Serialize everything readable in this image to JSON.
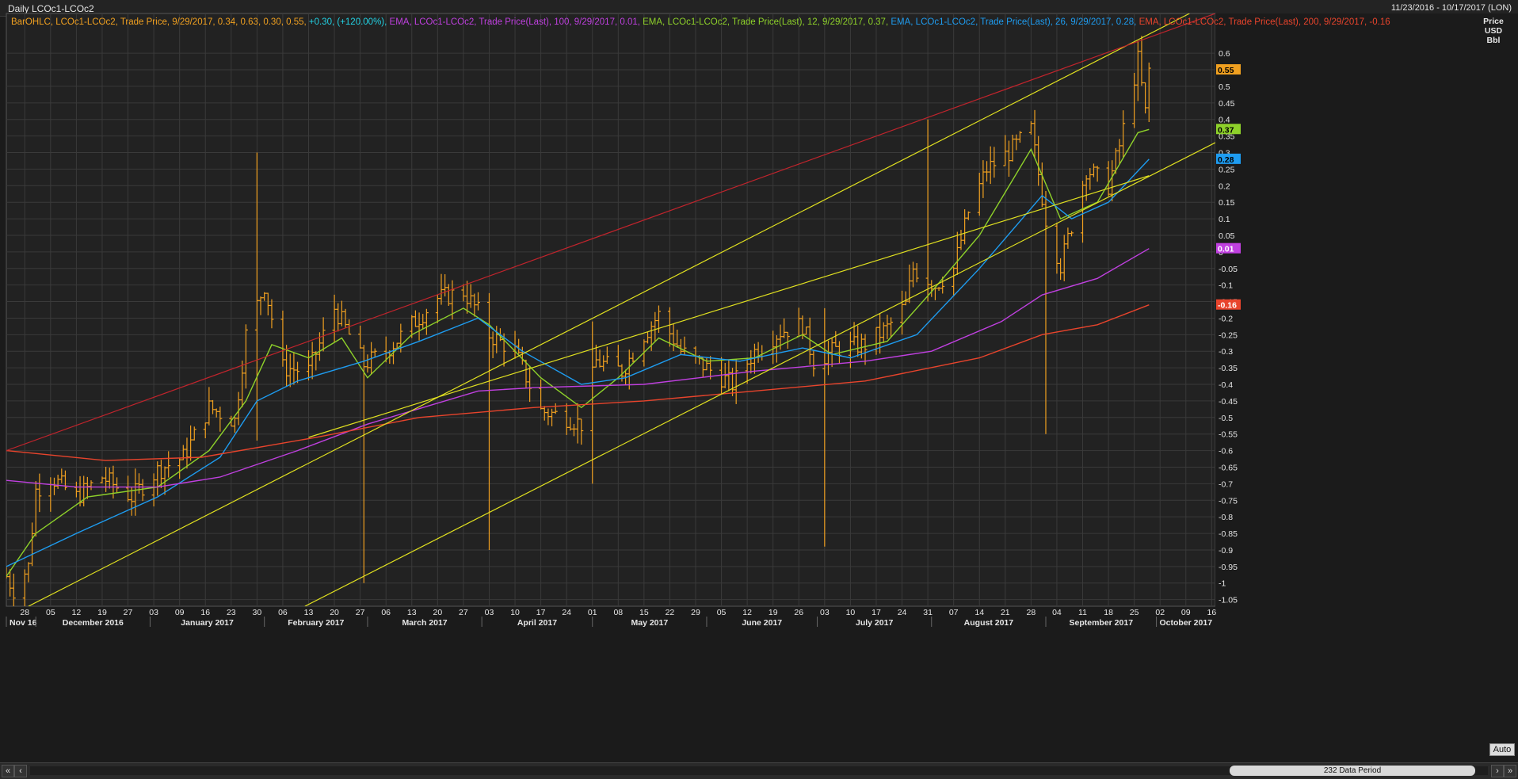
{
  "window": {
    "title": "Daily LCOc1-LCOc2",
    "date_range": "11/23/2016 - 10/17/2017 (LON)"
  },
  "legend": [
    {
      "text": "BarOHLC, LCOc1-LCOc2, Trade Price,  9/29/2017, 0.34, 0.63, 0.30, 0.55, ",
      "color": "#f0a020"
    },
    {
      "text": "+0.30, (+120.00%), ",
      "color": "#22d4e6"
    },
    {
      "text": "EMA, LCOc1-LCOc2, Trade Price(Last),  100,  9/29/2017, 0.01, ",
      "color": "#c040e0"
    },
    {
      "text": "EMA, LCOc1-LCOc2, Trade Price(Last),  12,  9/29/2017, 0.37, ",
      "color": "#8ed12a"
    },
    {
      "text": "EMA, LCOc1-LCOc2, Trade Price(Last),  26,  9/29/2017, 0.28, ",
      "color": "#1e9cf0"
    },
    {
      "text": "EMA, LCOc1-LCOc2, Trade Price(Last),  200,  9/29/2017, -0.16",
      "color": "#e8442c"
    }
  ],
  "axis": {
    "price_header": [
      "Price",
      "USD",
      "Bbl"
    ]
  },
  "scroll": {
    "period_label": "232 Data Period",
    "auto_label": "Auto",
    "left_double": "«",
    "left_single": "‹",
    "right_single": "›",
    "right_double": "»"
  },
  "chart_data": {
    "type": "ohlc",
    "title": "Daily LCOc1-LCOc2",
    "ylabel": "Price USD Bbl",
    "ylim": [
      -1.07,
      0.72
    ],
    "y_ticks": [
      0.6,
      0.55,
      0.5,
      0.45,
      0.4,
      0.35,
      0.3,
      0.25,
      0.2,
      0.15,
      0.1,
      0.05,
      0,
      -0.05,
      -0.1,
      -0.15,
      -0.2,
      -0.25,
      -0.3,
      -0.35,
      -0.4,
      -0.45,
      -0.5,
      -0.55,
      -0.6,
      -0.65,
      -0.7,
      -0.75,
      -0.8,
      -0.85,
      -0.9,
      -0.95,
      -1,
      -1.05
    ],
    "y_tick_labels": [
      "0.6",
      "0.55",
      "0.5",
      "0.45",
      "0.4",
      "0.35",
      "0.3",
      "0.25",
      "0.2",
      "0.15",
      "0.1",
      "0.05",
      "0",
      "-0.05",
      "-0.1",
      "-0.15",
      "-0.2",
      "-0.25",
      "-0.3",
      "-0.35",
      "-0.4",
      "-0.45",
      "-0.5",
      "-0.55",
      "-0.6",
      "-0.65",
      "-0.7",
      "-0.75",
      "-0.8",
      "-0.85",
      "-0.9",
      "-0.95",
      "-1",
      "-1.05"
    ],
    "x_day_ticks": [
      "28",
      "05",
      "12",
      "19",
      "27",
      "03",
      "09",
      "16",
      "23",
      "30",
      "06",
      "13",
      "20",
      "27",
      "06",
      "13",
      "20",
      "27",
      "03",
      "10",
      "17",
      "24",
      "01",
      "08",
      "15",
      "22",
      "29",
      "05",
      "12",
      "19",
      "26",
      "03",
      "10",
      "17",
      "24",
      "31",
      "07",
      "14",
      "21",
      "28",
      "04",
      "11",
      "18",
      "25",
      "02",
      "09",
      "16"
    ],
    "x_month_labels": [
      "Nov 16",
      "December 2016",
      "January 2017",
      "February 2017",
      "March 2017",
      "April 2017",
      "May 2017",
      "June 2017",
      "July 2017",
      "August 2017",
      "September 2017",
      "October 2017"
    ],
    "x_start": "2016-11-23",
    "x_end": "2017-10-17",
    "ohlc_anchors": [
      [
        "2016-11-23",
        -0.98
      ],
      [
        "2016-11-25",
        -1.02
      ],
      [
        "2016-11-29",
        -0.95
      ],
      [
        "2016-12-01",
        -0.72
      ],
      [
        "2016-12-05",
        -0.68
      ],
      [
        "2016-12-12",
        -0.74
      ],
      [
        "2016-12-19",
        -0.68
      ],
      [
        "2016-12-27",
        -0.74
      ],
      [
        "2017-01-03",
        -0.66
      ],
      [
        "2017-01-10",
        -0.62
      ],
      [
        "2017-01-17",
        -0.47
      ],
      [
        "2017-01-24",
        -0.51
      ],
      [
        "2017-01-27",
        -0.25
      ],
      [
        "2017-02-01",
        -0.1
      ],
      [
        "2017-02-06",
        -0.35
      ],
      [
        "2017-02-13",
        -0.36
      ],
      [
        "2017-02-20",
        -0.17
      ],
      [
        "2017-02-24",
        -0.25
      ],
      [
        "2017-02-28",
        -0.34
      ],
      [
        "2017-03-06",
        -0.3
      ],
      [
        "2017-03-13",
        -0.22
      ],
      [
        "2017-03-20",
        -0.14
      ],
      [
        "2017-03-27",
        -0.12
      ],
      [
        "2017-03-31",
        -0.18
      ],
      [
        "2017-04-03",
        -0.25
      ],
      [
        "2017-04-10",
        -0.3
      ],
      [
        "2017-04-17",
        -0.48
      ],
      [
        "2017-04-24",
        -0.5
      ],
      [
        "2017-04-28",
        -0.52
      ],
      [
        "2017-05-02",
        -0.33
      ],
      [
        "2017-05-09",
        -0.36
      ],
      [
        "2017-05-15",
        -0.25
      ],
      [
        "2017-05-19",
        -0.19
      ],
      [
        "2017-05-25",
        -0.3
      ],
      [
        "2017-06-01",
        -0.35
      ],
      [
        "2017-06-08",
        -0.4
      ],
      [
        "2017-06-14",
        -0.3
      ],
      [
        "2017-06-21",
        -0.24
      ],
      [
        "2017-06-27",
        -0.22
      ],
      [
        "2017-06-30",
        -0.33
      ],
      [
        "2017-07-07",
        -0.29
      ],
      [
        "2017-07-14",
        -0.28
      ],
      [
        "2017-07-20",
        -0.23
      ],
      [
        "2017-07-25",
        -0.16
      ],
      [
        "2017-07-27",
        -0.05
      ],
      [
        "2017-08-02",
        -0.1
      ],
      [
        "2017-08-07",
        -0.05
      ],
      [
        "2017-08-11",
        0.12
      ],
      [
        "2017-08-16",
        0.25
      ],
      [
        "2017-08-22",
        0.3
      ],
      [
        "2017-08-28",
        0.37
      ],
      [
        "2017-09-01",
        0.1
      ],
      [
        "2017-09-05",
        -0.04
      ],
      [
        "2017-09-08",
        0.08
      ],
      [
        "2017-09-12",
        0.25
      ],
      [
        "2017-09-18",
        0.2
      ],
      [
        "2017-09-21",
        0.32
      ],
      [
        "2017-09-26",
        0.58
      ],
      [
        "2017-09-28",
        0.42
      ],
      [
        "2017-09-29",
        0.55
      ]
    ],
    "spikes": [
      {
        "date": "2017-01-30",
        "high": 0.3,
        "low": -0.57
      },
      {
        "date": "2017-02-28",
        "high": -0.37,
        "low": -1.0
      },
      {
        "date": "2017-04-03",
        "high": -0.23,
        "low": -0.9
      },
      {
        "date": "2017-05-01",
        "high": -0.21,
        "low": -0.7
      },
      {
        "date": "2017-07-03",
        "high": -0.17,
        "low": -0.89
      },
      {
        "date": "2017-07-31",
        "high": 0.4,
        "low": -0.15
      },
      {
        "date": "2017-09-01",
        "high": 0.1,
        "low": -0.55
      }
    ],
    "series": [
      {
        "name": "EMA 12",
        "color": "#8ed12a",
        "points": [
          [
            "2016-11-23",
            -0.98
          ],
          [
            "2016-12-01",
            -0.85
          ],
          [
            "2016-12-15",
            -0.74
          ],
          [
            "2017-01-03",
            -0.71
          ],
          [
            "2017-01-17",
            -0.6
          ],
          [
            "2017-01-27",
            -0.45
          ],
          [
            "2017-02-03",
            -0.28
          ],
          [
            "2017-02-13",
            -0.32
          ],
          [
            "2017-02-22",
            -0.26
          ],
          [
            "2017-03-01",
            -0.38
          ],
          [
            "2017-03-13",
            -0.25
          ],
          [
            "2017-03-27",
            -0.17
          ],
          [
            "2017-04-03",
            -0.22
          ],
          [
            "2017-04-17",
            -0.38
          ],
          [
            "2017-04-28",
            -0.47
          ],
          [
            "2017-05-08",
            -0.38
          ],
          [
            "2017-05-19",
            -0.26
          ],
          [
            "2017-06-01",
            -0.33
          ],
          [
            "2017-06-14",
            -0.32
          ],
          [
            "2017-06-27",
            -0.25
          ],
          [
            "2017-07-05",
            -0.31
          ],
          [
            "2017-07-20",
            -0.27
          ],
          [
            "2017-08-01",
            -0.12
          ],
          [
            "2017-08-14",
            0.05
          ],
          [
            "2017-08-28",
            0.31
          ],
          [
            "2017-09-05",
            0.1
          ],
          [
            "2017-09-15",
            0.15
          ],
          [
            "2017-09-26",
            0.36
          ],
          [
            "2017-09-29",
            0.37
          ]
        ]
      },
      {
        "name": "EMA 26",
        "color": "#1e9cf0",
        "points": [
          [
            "2016-11-23",
            -0.95
          ],
          [
            "2016-12-12",
            -0.85
          ],
          [
            "2017-01-03",
            -0.74
          ],
          [
            "2017-01-20",
            -0.62
          ],
          [
            "2017-01-30",
            -0.45
          ],
          [
            "2017-02-10",
            -0.39
          ],
          [
            "2017-02-28",
            -0.33
          ],
          [
            "2017-03-15",
            -0.27
          ],
          [
            "2017-03-31",
            -0.2
          ],
          [
            "2017-04-12",
            -0.3
          ],
          [
            "2017-04-28",
            -0.4
          ],
          [
            "2017-05-10",
            -0.38
          ],
          [
            "2017-05-25",
            -0.31
          ],
          [
            "2017-06-10",
            -0.33
          ],
          [
            "2017-06-27",
            -0.29
          ],
          [
            "2017-07-10",
            -0.32
          ],
          [
            "2017-07-28",
            -0.25
          ],
          [
            "2017-08-14",
            -0.05
          ],
          [
            "2017-08-31",
            0.17
          ],
          [
            "2017-09-08",
            0.1
          ],
          [
            "2017-09-18",
            0.15
          ],
          [
            "2017-09-29",
            0.28
          ]
        ]
      },
      {
        "name": "EMA 100",
        "color": "#c040e0",
        "points": [
          [
            "2016-11-23",
            -0.69
          ],
          [
            "2016-12-12",
            -0.71
          ],
          [
            "2017-01-03",
            -0.71
          ],
          [
            "2017-01-20",
            -0.68
          ],
          [
            "2017-02-10",
            -0.6
          ],
          [
            "2017-03-01",
            -0.52
          ],
          [
            "2017-03-31",
            -0.42
          ],
          [
            "2017-04-15",
            -0.41
          ],
          [
            "2017-05-15",
            -0.4
          ],
          [
            "2017-06-14",
            -0.36
          ],
          [
            "2017-07-14",
            -0.33
          ],
          [
            "2017-08-01",
            -0.3
          ],
          [
            "2017-08-20",
            -0.21
          ],
          [
            "2017-08-31",
            -0.13
          ],
          [
            "2017-09-15",
            -0.08
          ],
          [
            "2017-09-29",
            0.01
          ]
        ]
      },
      {
        "name": "EMA 200",
        "color": "#e8442c",
        "points": [
          [
            "2016-11-23",
            -0.6
          ],
          [
            "2016-12-20",
            -0.63
          ],
          [
            "2017-01-15",
            -0.62
          ],
          [
            "2017-02-15",
            -0.56
          ],
          [
            "2017-03-15",
            -0.5
          ],
          [
            "2017-04-15",
            -0.47
          ],
          [
            "2017-05-15",
            -0.45
          ],
          [
            "2017-06-14",
            -0.42
          ],
          [
            "2017-07-14",
            -0.39
          ],
          [
            "2017-08-14",
            -0.32
          ],
          [
            "2017-08-31",
            -0.25
          ],
          [
            "2017-09-15",
            -0.22
          ],
          [
            "2017-09-29",
            -0.16
          ]
        ]
      }
    ],
    "trendlines": [
      {
        "color": "#e0e020",
        "from": [
          "2016-11-29",
          -1.07
        ],
        "to": [
          "2017-10-10",
          0.72
        ]
      },
      {
        "color": "#e0e020",
        "from": [
          "2017-02-12",
          -1.07
        ],
        "to": [
          "2017-10-17",
          0.33
        ]
      },
      {
        "color": "#e0e020",
        "from": [
          "2017-02-13",
          -0.56
        ],
        "to": [
          "2017-09-29",
          0.23
        ]
      },
      {
        "color": "#c0242c",
        "from": [
          "2016-11-23",
          -0.6
        ],
        "to": [
          "2017-10-17",
          0.72
        ]
      }
    ],
    "price_markers": [
      {
        "value": 0.55,
        "label": "0.55",
        "bg": "#f0a020",
        "fg": "#000000"
      },
      {
        "value": 0.37,
        "label": "0.37",
        "bg": "#8ed12a",
        "fg": "#000000"
      },
      {
        "value": 0.28,
        "label": "0.28",
        "bg": "#1e9cf0",
        "fg": "#000000"
      },
      {
        "value": 0.01,
        "label": "0.01",
        "bg": "#c040e0",
        "fg": "#ffffff"
      },
      {
        "value": -0.16,
        "label": "-0.16",
        "bg": "#e8442c",
        "fg": "#ffffff"
      }
    ],
    "colors": {
      "bars": "#f0a020",
      "grid": "#3a3a3a",
      "background": "#222222",
      "axis_text": "#e6e6e6"
    },
    "grid": true
  }
}
